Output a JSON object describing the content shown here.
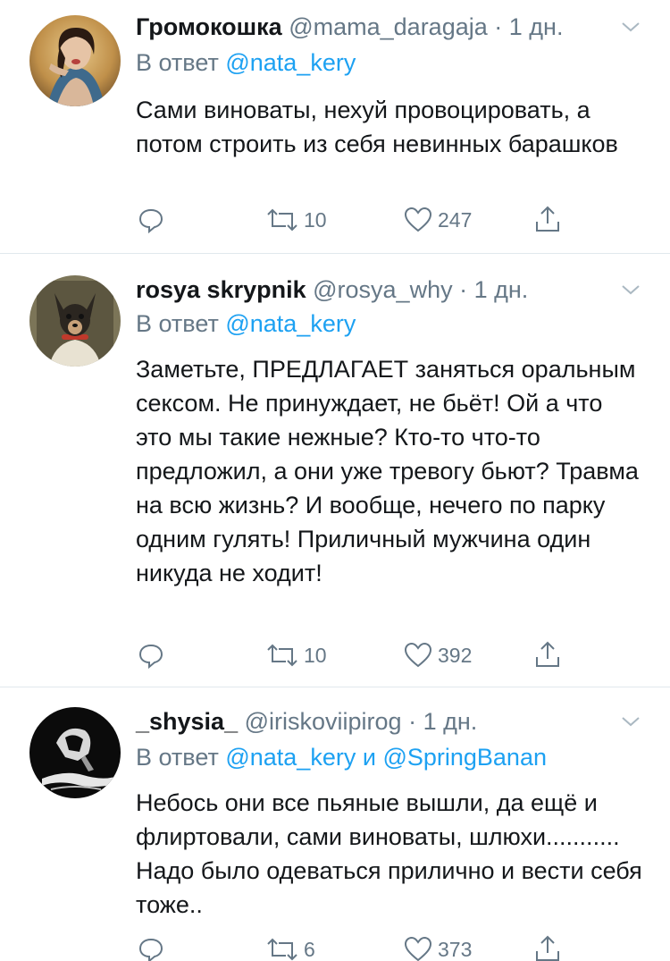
{
  "tweets": [
    {
      "name": "Громокошка",
      "handle": "@mama_daragaja",
      "dot": "·",
      "time": "1 дн.",
      "reply_prefix": "В ответ",
      "reply_mentions": "@nata_kery",
      "reply_joiner": "",
      "reply_mentions_2": "",
      "text": "Сами виноваты, нехуй провоцировать, а потом строить из себя невинных барашков",
      "retweets": "10",
      "likes": "247",
      "avatar_icon": "avatar-woman-portrait"
    },
    {
      "name": "rosya skrypnik",
      "handle": "@rosya_why",
      "dot": "·",
      "time": "1 дн.",
      "reply_prefix": "В ответ",
      "reply_mentions": "@nata_kery",
      "reply_joiner": "",
      "reply_mentions_2": "",
      "text": "Заметьте, ПРЕДЛАГАЕТ заняться оральным сексом. Не принуждает, не бьёт! Ой а что это мы такие нежные? Кто-то что-то предложил, а они уже тревогу бьют? Травма на всю жизнь? И вообще, нечего по парку одним гулять! Приличный мужчина один никуда не ходит!",
      "retweets": "10",
      "likes": "392",
      "avatar_icon": "avatar-dog-portrait"
    },
    {
      "name": "_shysia_",
      "handle": "@iriskoviipirog",
      "dot": "·",
      "time": "1 дн.",
      "reply_prefix": "В ответ",
      "reply_mentions": "@nata_kery",
      "reply_joiner": "и",
      "reply_mentions_2": "@SpringBanan",
      "text": "Небось они все пьяные вышли, да ещё и флиртовали, сами виноваты, шлюхи........... Надо было одеваться прилично и вести себя тоже..",
      "retweets": "6",
      "likes": "373",
      "avatar_icon": "avatar-dark-figure"
    }
  ],
  "colors": {
    "text": "#14171a",
    "secondary": "#657786",
    "link": "#1da1f2",
    "divider": "#e1e8ed"
  },
  "icons": {
    "reply": "reply-icon",
    "retweet": "retweet-icon",
    "like": "heart-icon",
    "share": "share-icon",
    "caret": "chevron-down-icon"
  }
}
